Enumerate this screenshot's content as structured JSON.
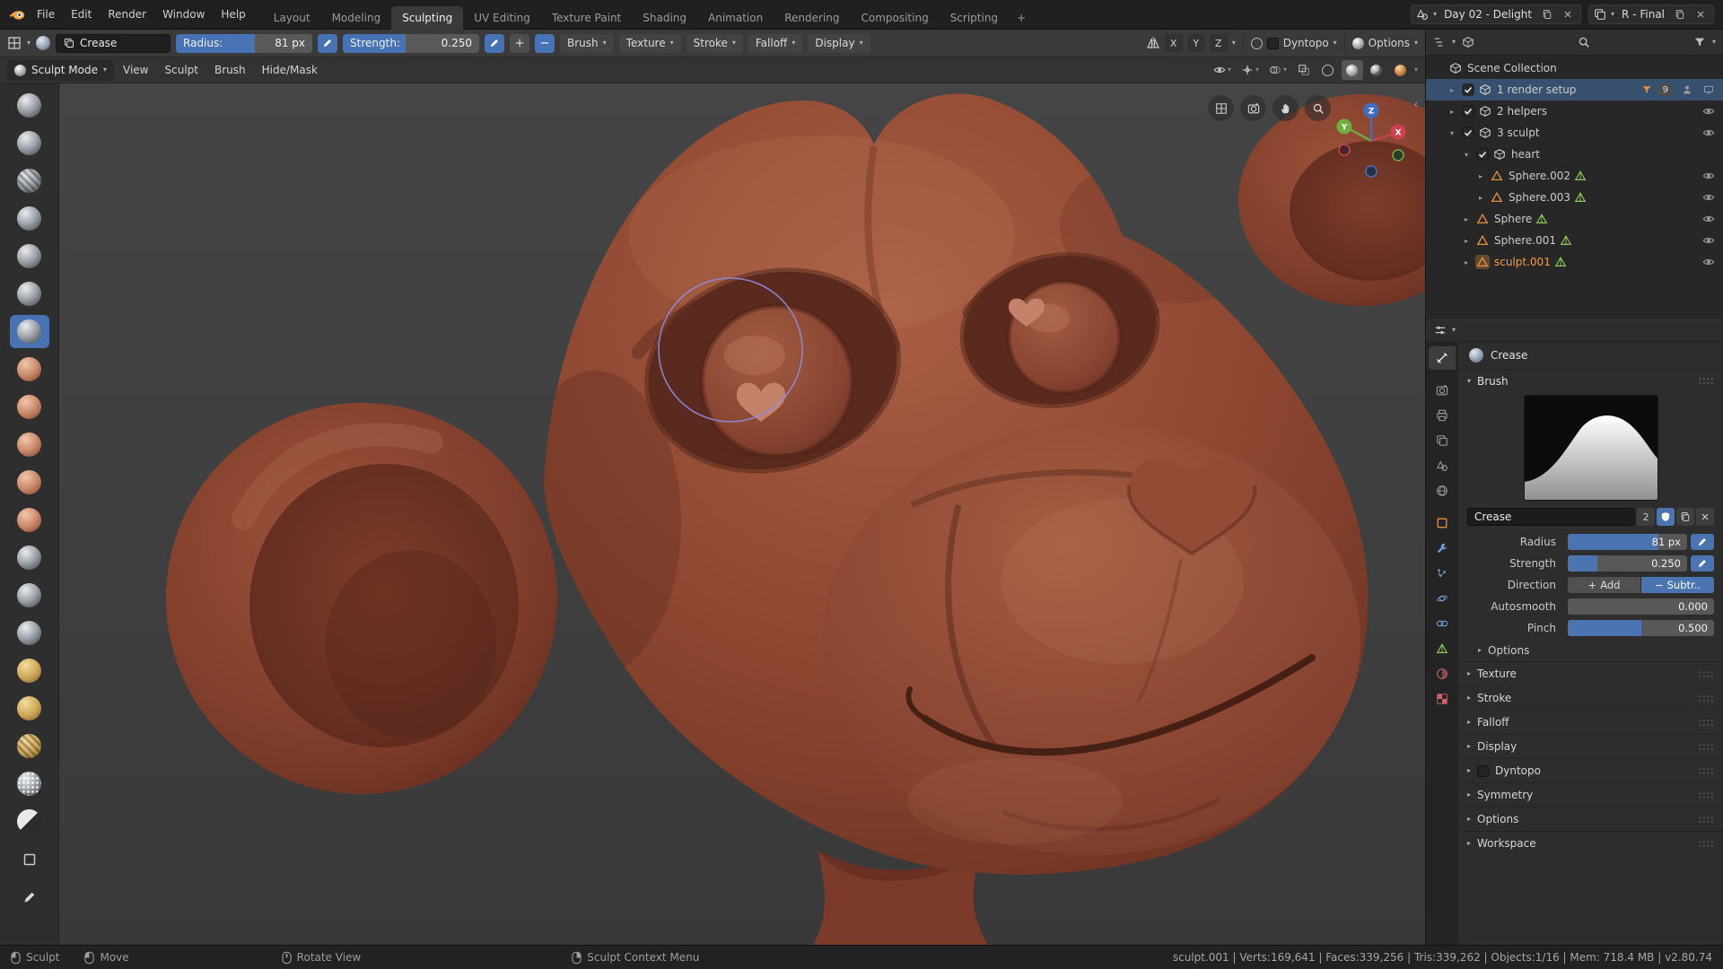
{
  "topbar": {
    "menus": [
      {
        "label": "File"
      },
      {
        "label": "Edit"
      },
      {
        "label": "Render"
      },
      {
        "label": "Window"
      },
      {
        "label": "Help"
      }
    ],
    "tabs": [
      {
        "label": "Layout"
      },
      {
        "label": "Modeling"
      },
      {
        "label": "Sculpting"
      },
      {
        "label": "UV Editing"
      },
      {
        "label": "Texture Paint"
      },
      {
        "label": "Shading"
      },
      {
        "label": "Animation"
      },
      {
        "label": "Rendering"
      },
      {
        "label": "Compositing"
      },
      {
        "label": "Scripting"
      }
    ],
    "active_tab": "Sculpting",
    "new_tab_label": "+",
    "scene_name": "Day 02 - Delight",
    "view_layer_name": "R - Final"
  },
  "tool_settings": {
    "brush_name": "Crease",
    "radius_label": "Radius:",
    "radius_value": "81 px",
    "strength_label": "Strength:",
    "strength_value": "0.250",
    "add_label": "+",
    "subtract_label": "−",
    "menus": [
      {
        "label": "Brush"
      },
      {
        "label": "Texture"
      },
      {
        "label": "Stroke"
      },
      {
        "label": "Falloff"
      },
      {
        "label": "Display"
      }
    ],
    "mirror_axes": [
      {
        "label": "X"
      },
      {
        "label": "Y"
      },
      {
        "label": "Z"
      }
    ],
    "dyntopo_label": "Dyntopo",
    "options_label": "Options"
  },
  "viewport_header": {
    "mode_label": "Sculpt Mode",
    "menus": [
      {
        "label": "View"
      },
      {
        "label": "Sculpt"
      },
      {
        "label": "Brush"
      },
      {
        "label": "Hide/Mask"
      }
    ]
  },
  "toolbar": {
    "active_brush": "crease",
    "brushes": [
      "draw",
      "clay",
      "clay-strips",
      "layer",
      "inflate",
      "blob",
      "crease",
      "smooth",
      "flatten",
      "fill",
      "scrape",
      "pinch",
      "grab",
      "snake-hook",
      "thumb",
      "nudge",
      "rotate",
      "slide-relax",
      "mask",
      "box-mask",
      "box-hide",
      "annotate"
    ]
  },
  "viewport": {
    "gizmo_axes": [
      {
        "label": "X"
      },
      {
        "label": "Y"
      },
      {
        "label": "Z"
      }
    ]
  },
  "outliner": {
    "rows": [
      {
        "label": "Scene Collection"
      },
      {
        "label": "1 render setup",
        "badge": "9"
      },
      {
        "label": "2 helpers"
      },
      {
        "label": "3 sculpt"
      },
      {
        "label": "heart"
      },
      {
        "label": "Sphere.002"
      },
      {
        "label": "Sphere.003"
      },
      {
        "label": "Sphere"
      },
      {
        "label": "Sphere.001"
      },
      {
        "label": "sculpt.001"
      }
    ]
  },
  "properties": {
    "active_tool_name": "Crease",
    "brush": {
      "panel_title": "Brush",
      "name_value": "Crease",
      "user_count": "2",
      "radius_label": "Radius",
      "radius_value": "81 px",
      "strength_label": "Strength",
      "strength_value": "0.250",
      "direction_label": "Direction",
      "direction_add_glyph": "+",
      "direction_subtract_glyph": "−",
      "add_label": "Add",
      "subtract_label": "Subtr..",
      "autosmooth_label": "Autosmooth",
      "autosmooth_value": "0.000",
      "pinch_label": "Pinch",
      "pinch_value": "0.500",
      "options_subpanel_label": "Options"
    },
    "panels": [
      {
        "label": "Texture"
      },
      {
        "label": "Stroke"
      },
      {
        "label": "Falloff"
      },
      {
        "label": "Display"
      },
      {
        "label": "Dyntopo"
      },
      {
        "label": "Symmetry"
      },
      {
        "label": "Options"
      },
      {
        "label": "Workspace"
      }
    ]
  },
  "statusbar": {
    "hints": [
      {
        "label": "Sculpt"
      },
      {
        "label": "Move"
      },
      {
        "label": "Rotate View"
      },
      {
        "label": "Sculpt Context Menu"
      }
    ],
    "info": "sculpt.001 | Verts:169,641 | Faces:339,256 | Tris:339,262 | Objects:1/16 | Mem: 718.4 MB | v2.80.74"
  },
  "colors": {
    "accent": "#4772b3",
    "selection_row": "#36506e",
    "active_object_text": "#f0a14f",
    "object_icon": "#e8913e",
    "mesh_data_icon": "#8fce5a",
    "axis_x": "#cc4250",
    "axis_y": "#6fae3f",
    "axis_z": "#3f6fc4"
  }
}
